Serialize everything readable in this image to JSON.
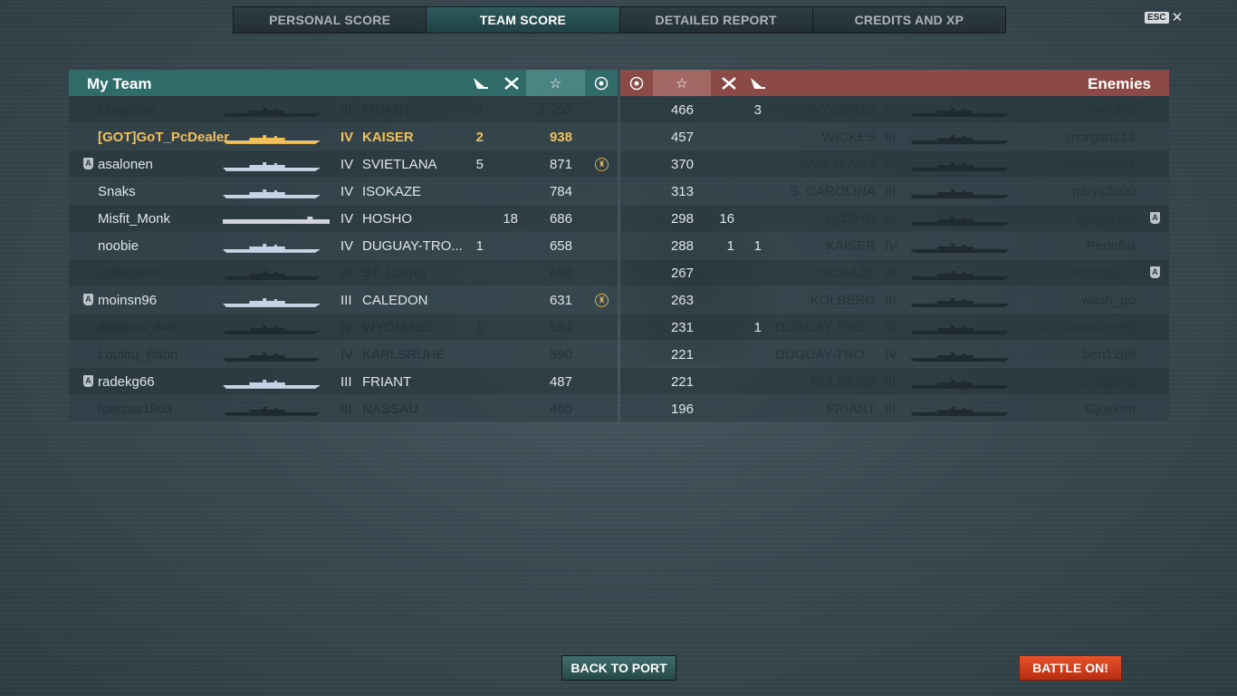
{
  "tabs": [
    {
      "label": "PERSONAL SCORE",
      "active": false
    },
    {
      "label": "TEAM SCORE",
      "active": true
    },
    {
      "label": "DETAILED REPORT",
      "active": false
    },
    {
      "label": "CREDITS AND XP",
      "active": false
    }
  ],
  "esc": {
    "key": "ESC",
    "close": "✕"
  },
  "my_team": {
    "title": "My Team",
    "header_icons": [
      "torpedo-icon",
      "planes-icon",
      "star-icon",
      "medal-icon"
    ],
    "rows": [
      {
        "player": "Lihapiiras",
        "tier": "III",
        "ship": "FRIANT",
        "kills": "3",
        "planes": "",
        "score": "1 253",
        "status": "dead",
        "badge": false,
        "medal": false,
        "silhouette": "dark"
      },
      {
        "player": "[GOT]GoT_PcDealer",
        "tier": "IV",
        "ship": "KAISER",
        "kills": "2",
        "planes": "",
        "score": "938",
        "status": "self",
        "badge": false,
        "medal": false,
        "silhouette": "gold"
      },
      {
        "player": "asalonen",
        "tier": "IV",
        "ship": "SVIETLANA",
        "kills": "5",
        "planes": "",
        "score": "871",
        "status": "alive",
        "badge": true,
        "medal": true,
        "silhouette": "light"
      },
      {
        "player": "Snaks",
        "tier": "IV",
        "ship": "ISOKAZE",
        "kills": "",
        "planes": "",
        "score": "784",
        "status": "alive",
        "badge": false,
        "medal": false,
        "silhouette": "light"
      },
      {
        "player": "Misfit_Monk",
        "tier": "IV",
        "ship": "HOSHO",
        "kills": "",
        "planes": "18",
        "score": "686",
        "status": "alive",
        "badge": false,
        "medal": false,
        "silhouette": "carrier"
      },
      {
        "player": "noobie",
        "tier": "IV",
        "ship": "DUGUAY-TRO...",
        "kills": "1",
        "planes": "",
        "score": "658",
        "status": "alive",
        "badge": false,
        "medal": false,
        "silhouette": "light"
      },
      {
        "player": "Cutie2000",
        "tier": "III",
        "ship": "ST. LOUIS",
        "kills": "",
        "planes": "",
        "score": "650",
        "status": "dead",
        "badge": false,
        "medal": false,
        "silhouette": "dark"
      },
      {
        "player": "moinsn96",
        "tier": "III",
        "ship": "CALEDON",
        "kills": "",
        "planes": "",
        "score": "631",
        "status": "alive",
        "badge": true,
        "medal": true,
        "silhouette": "light"
      },
      {
        "player": "albatros_848",
        "tier": "IV",
        "ship": "WYOMING",
        "kills": "1",
        "planes": "",
        "score": "594",
        "status": "dead",
        "badge": false,
        "medal": false,
        "silhouette": "dark"
      },
      {
        "player": "Loulou_Riton",
        "tier": "IV",
        "ship": "KARLSRUHE",
        "kills": "",
        "planes": "",
        "score": "590",
        "status": "dead",
        "badge": false,
        "medal": false,
        "silhouette": "dark"
      },
      {
        "player": "radekg66",
        "tier": "III",
        "ship": "FRIANT",
        "kills": "",
        "planes": "",
        "score": "487",
        "status": "alive",
        "badge": true,
        "medal": false,
        "silhouette": "light"
      },
      {
        "player": "tuercas1963",
        "tier": "III",
        "ship": "NASSAU",
        "kills": "",
        "planes": "",
        "score": "460",
        "status": "dead",
        "badge": false,
        "medal": false,
        "silhouette": "dark"
      }
    ]
  },
  "enemies": {
    "title": "Enemies",
    "header_icons": [
      "medal-icon",
      "star-icon",
      "planes-icon",
      "torpedo-icon"
    ],
    "rows": [
      {
        "player": "Bodyfire",
        "tier": "IV",
        "ship": "WYOMING",
        "score": "466",
        "planes": "",
        "kills": "3",
        "badge": false
      },
      {
        "player": "morgan213",
        "tier": "III",
        "ship": "WICKES",
        "score": "457",
        "planes": "",
        "kills": "",
        "badge": false
      },
      {
        "player": "stevan1967",
        "tier": "IV",
        "ship": "SVIETLANA",
        "score": "370",
        "planes": "",
        "kills": "",
        "badge": false
      },
      {
        "player": "parys2000",
        "tier": "III",
        "ship": "S. CAROLINA",
        "score": "313",
        "planes": "",
        "kills": "",
        "badge": false
      },
      {
        "player": "SyrusLOL",
        "tier": "IV",
        "ship": "HOSHO",
        "score": "298",
        "planes": "16",
        "kills": "",
        "badge": true
      },
      {
        "player": "Perinfist",
        "tier": "IV",
        "ship": "KAISER",
        "score": "288",
        "planes": "1",
        "kills": "1",
        "badge": false
      },
      {
        "player": "RomsasLT",
        "tier": "IV",
        "ship": "ISOKAZE",
        "score": "267",
        "planes": "",
        "kills": "",
        "badge": true
      },
      {
        "player": "wash_go",
        "tier": "III",
        "ship": "KOLBERG",
        "score": "263",
        "planes": "",
        "kills": "",
        "badge": false
      },
      {
        "player": "21_Skanderbeg",
        "tier": "IV",
        "ship": "DUGUAY-TRO...",
        "score": "231",
        "planes": "",
        "kills": "1",
        "badge": false
      },
      {
        "player": "ben1269",
        "tier": "IV",
        "ship": "DUGUAY-TRO...",
        "score": "221",
        "planes": "",
        "kills": "",
        "badge": false
      },
      {
        "player": "shotgung",
        "tier": "III",
        "ship": "KOLBERG",
        "score": "221",
        "planes": "",
        "kills": "",
        "badge": false
      },
      {
        "player": "Gjoeken",
        "tier": "III",
        "ship": "FRIANT",
        "score": "196",
        "planes": "",
        "kills": "",
        "badge": false
      }
    ]
  },
  "buttons": {
    "back": "BACK TO PORT",
    "battle": "BATTLE ON!"
  },
  "colors": {
    "my_team_header": "#2f6b68",
    "enemy_header": "#8b4a45",
    "self_highlight": "#f1c05a",
    "battle_button": "#d8401d"
  }
}
